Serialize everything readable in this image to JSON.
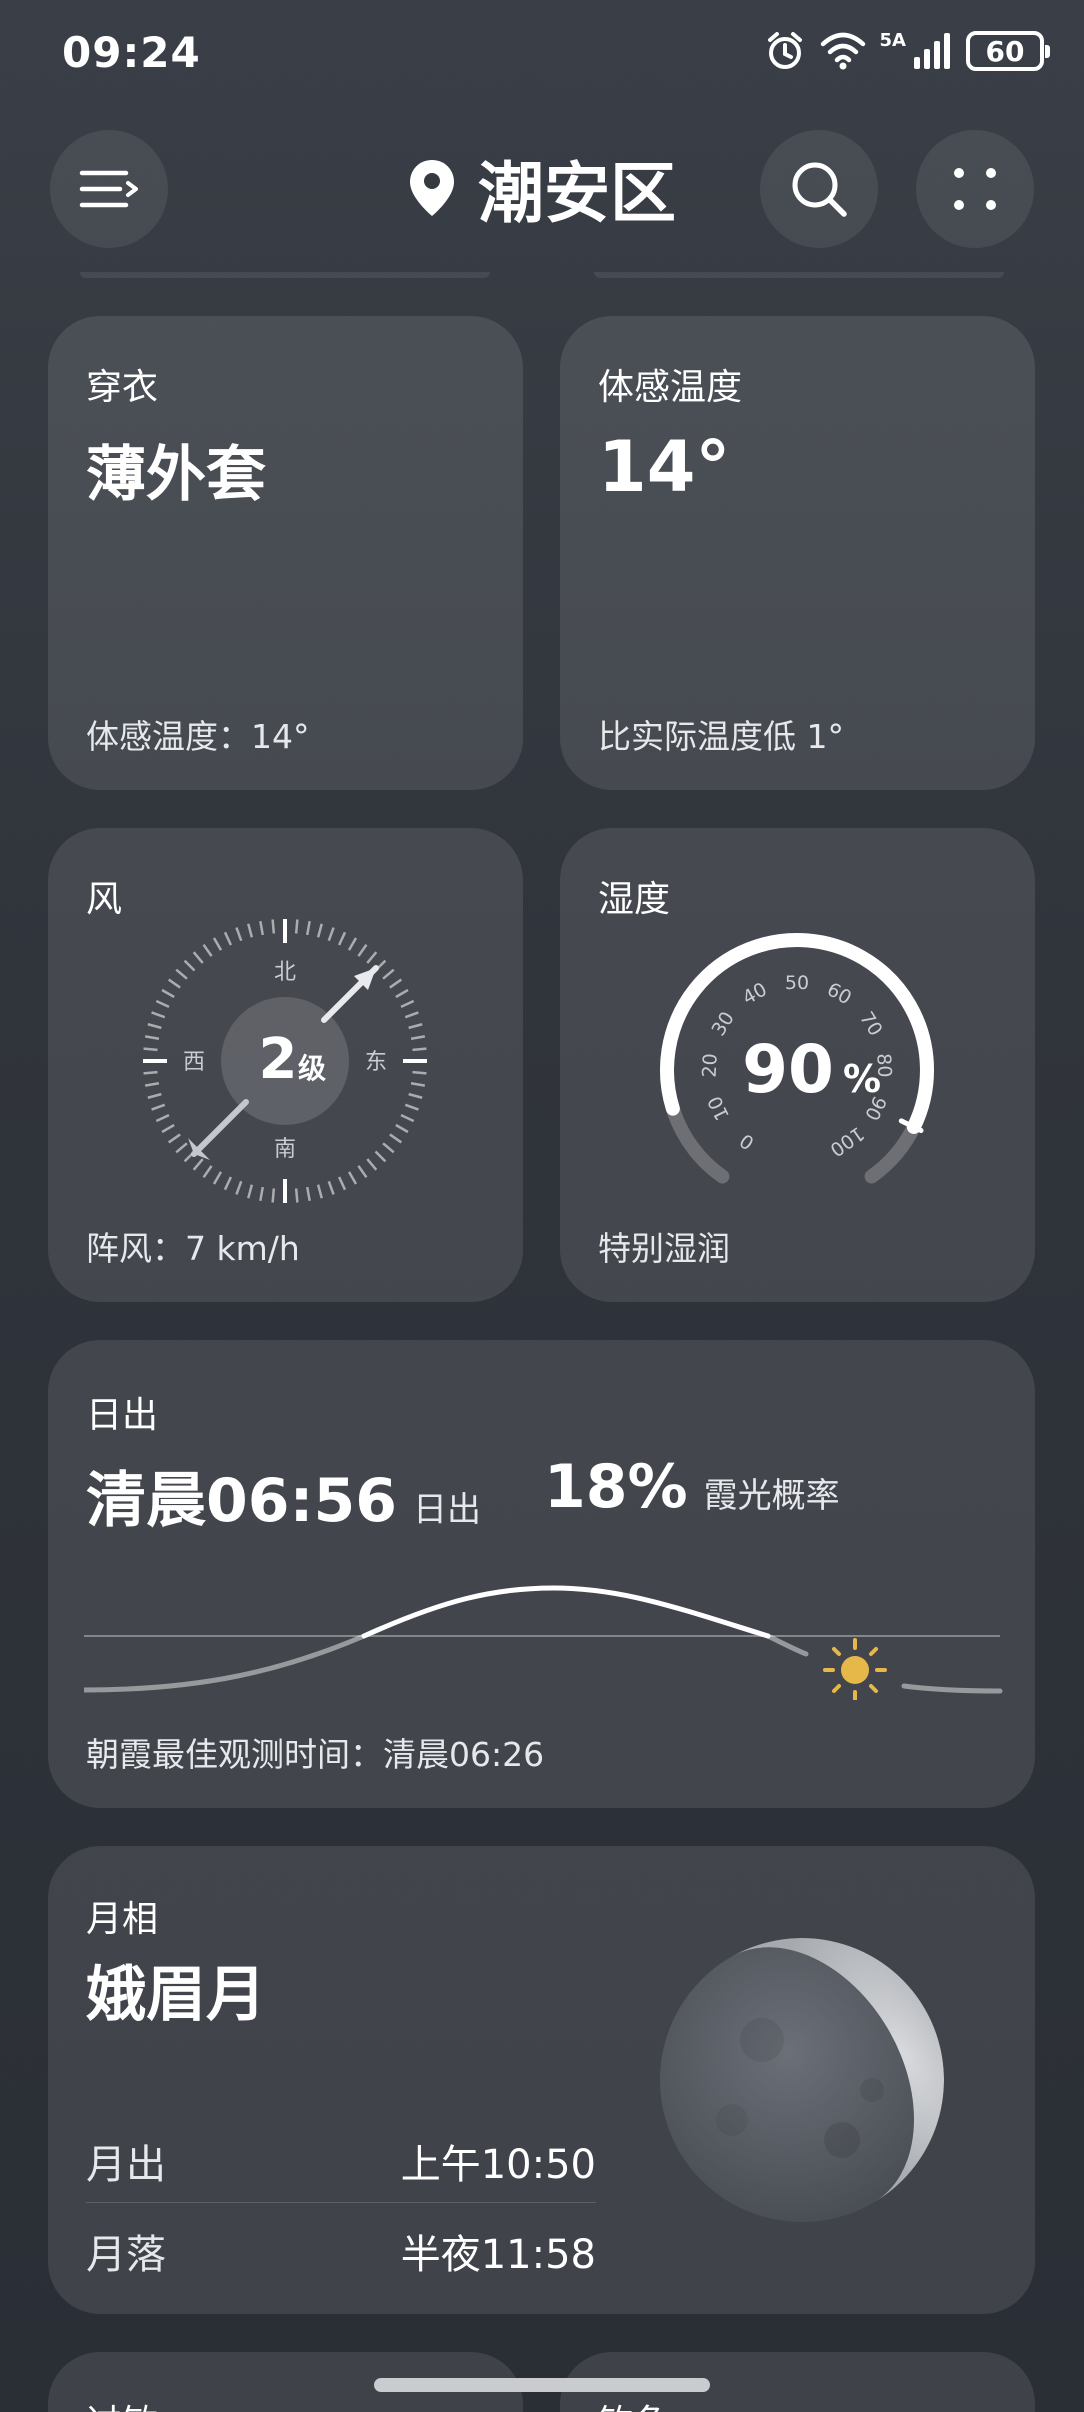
{
  "status_bar": {
    "time": "09:24",
    "network": "5A",
    "battery": "60",
    "icons": [
      "alarm-icon",
      "wifi-icon",
      "signal-icon",
      "battery-icon"
    ]
  },
  "header": {
    "location": "潮安区",
    "icons": [
      "menu-icon",
      "location-pin-icon",
      "search-icon",
      "more-icon"
    ]
  },
  "clothing": {
    "label": "穿衣",
    "value": "薄外套",
    "footer": "体感温度：14°"
  },
  "feels_like": {
    "label": "体感温度",
    "value": "14°",
    "footer": "比实际温度低 1°"
  },
  "wind": {
    "label": "风",
    "level_number": "2",
    "level_unit": "级",
    "north": "北",
    "south": "南",
    "east": "东",
    "west": "西",
    "footer": "阵风：7 km/h"
  },
  "humidity": {
    "label": "湿度",
    "value": "90",
    "unit": "%",
    "percent": 90,
    "scale": [
      "0",
      "10",
      "20",
      "30",
      "40",
      "50",
      "60",
      "70",
      "80",
      "90",
      "100"
    ],
    "footer": "特别湿润"
  },
  "sunrise": {
    "label": "日出",
    "time_value": "清晨06:56",
    "time_caption": "日出",
    "glow_value": "18%",
    "glow_caption": "霞光概率",
    "footer": "朝霞最佳观测时间：清晨06:26"
  },
  "moon": {
    "label": "月相",
    "phase": "娥眉月",
    "rise_label": "月出",
    "rise_time": "上午10:50",
    "set_label": "月落",
    "set_time": "半夜11:58"
  },
  "bottom_peek": {
    "left": "过敏",
    "right": "钓鱼"
  },
  "colors": {
    "background": "#30343b",
    "card": "#464b53",
    "sun": "#e6b84a"
  }
}
